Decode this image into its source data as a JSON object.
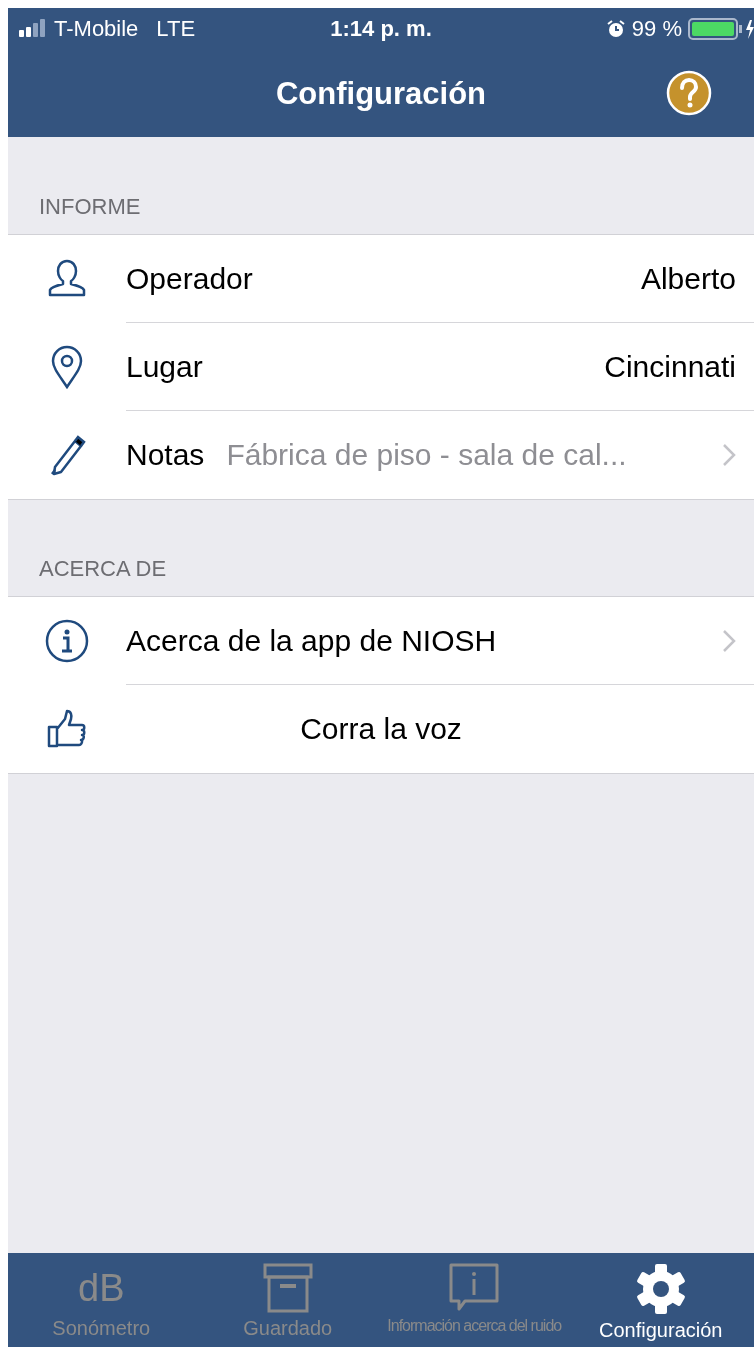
{
  "status_bar": {
    "carrier": "T-Mobile",
    "network": "LTE",
    "time": "1:14 p. m.",
    "battery": "99 %"
  },
  "nav": {
    "title": "Configuración"
  },
  "sections": [
    {
      "header": "INFORME",
      "rows": [
        {
          "kind": "value",
          "label": "Operador",
          "value": "Alberto",
          "chevron": false
        },
        {
          "kind": "value",
          "label": "Lugar",
          "value": "Cincinnati",
          "chevron": false
        },
        {
          "kind": "note",
          "label": "Notas",
          "value": "Fábrica de piso - sala de cal...",
          "chevron": true
        }
      ]
    },
    {
      "header": "ACERCA DE",
      "rows": [
        {
          "kind": "link",
          "label": "Acerca de la app de NIOSH",
          "chevron": true
        },
        {
          "kind": "center",
          "label": "Corra la voz",
          "chevron": false
        }
      ]
    }
  ],
  "tabs": [
    {
      "glyph": "dB",
      "label": "Sonómetro",
      "selected": false
    },
    {
      "label": "Guardado",
      "selected": false
    },
    {
      "label": "Información acerca del ruido",
      "selected": false
    },
    {
      "label": "Configuración",
      "selected": true
    }
  ]
}
